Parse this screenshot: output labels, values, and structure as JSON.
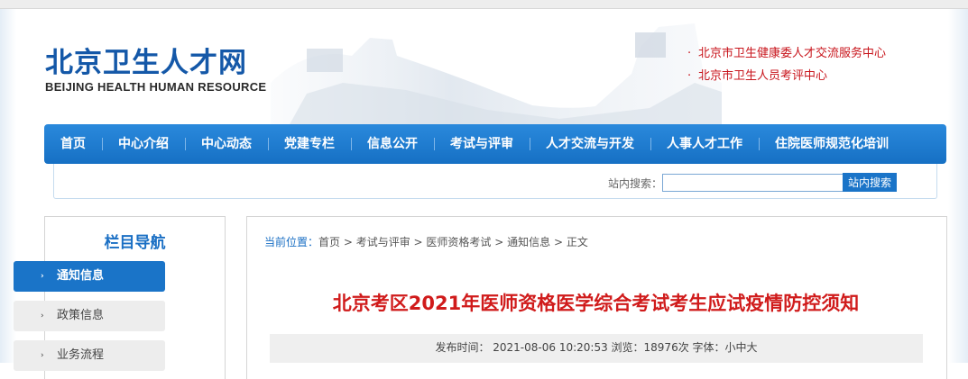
{
  "header": {
    "site_title": "北京卫生人才网",
    "site_subtitle": "BEIJING HEALTH HUMAN RESOURCE",
    "links": [
      {
        "label": "北京市卫生健康委人才交流服务中心"
      },
      {
        "label": "北京市卫生人员考评中心"
      }
    ],
    "link_bullet": "·"
  },
  "nav": {
    "items": [
      {
        "label": "首页"
      },
      {
        "label": "中心介绍"
      },
      {
        "label": "中心动态"
      },
      {
        "label": "党建专栏"
      },
      {
        "label": "信息公开"
      },
      {
        "label": "考试与评审"
      },
      {
        "label": "人才交流与开发"
      },
      {
        "label": "人事人才工作"
      },
      {
        "label": "住院医师规范化培训"
      }
    ]
  },
  "search": {
    "label": "站内搜索：",
    "value": "",
    "button_label": "站内搜索"
  },
  "sidebar": {
    "title": "栏目导航",
    "arrow": "›",
    "items": [
      {
        "label": "通知信息",
        "active": true
      },
      {
        "label": "政策信息",
        "active": false
      },
      {
        "label": "业务流程",
        "active": false
      }
    ]
  },
  "breadcrumb": {
    "lead": "当前位置：",
    "items": [
      "首页",
      "考试与评审",
      "医师资格考试",
      "通知信息",
      "正文"
    ],
    "separator": " > "
  },
  "article": {
    "title": "北京考区2021年医师资格医学综合考试考生应试疫情防控须知",
    "meta": "发布时间： 2021-08-06 10:20:53 浏览：18976次 字体：小中大"
  },
  "colors": {
    "accent_blue": "#1a74c8",
    "title_red": "#d01b1b",
    "link_red": "#c8151c"
  }
}
